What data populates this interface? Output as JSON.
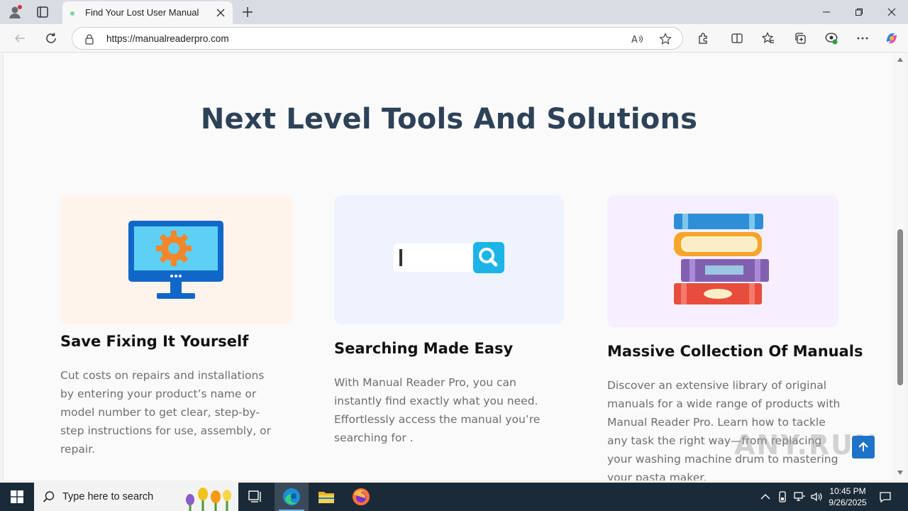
{
  "browser": {
    "tab_title": "Find Your Lost User Manual",
    "url": "https://manualreaderpro.com",
    "icons": [
      "profile-icon",
      "tab-actions-icon",
      "close-tab-icon",
      "new-tab-icon",
      "minimize-icon",
      "restore-icon",
      "close-window-icon",
      "back-icon",
      "refresh-icon",
      "site-info-icon",
      "read-aloud-icon",
      "favorite-add-icon",
      "extensions-icon",
      "split-screen-icon",
      "favorites-icon",
      "collections-icon",
      "browser-essentials-icon",
      "more-icon",
      "copilot-icon"
    ]
  },
  "page": {
    "section_title": "Next Level Tools And Solutions",
    "cards": [
      {
        "title": "Save Fixing It Yourself",
        "text": "Cut costs on repairs and installations by entering your product’s name or model number to get clear, step-by-step instructions for use, assembly, or repair.",
        "image": "monitor-gear-icon",
        "bg": "#fff4ec"
      },
      {
        "title": "Searching Made Easy",
        "text": "With Manual Reader Pro, you can instantly find exactly what you need. Effortlessly access the manual you’re searching for .",
        "image": "search-bar-icon",
        "bg": "#eef3fd"
      },
      {
        "title": "Massive Collection Of Manuals",
        "text": "Discover an extensive library of original manuals for a wide range of products with Manual Reader Pro. Learn how to tackle any task the right way—from replacing your washing machine drum to mastering your pasta maker.",
        "image": "books-stack-icon",
        "bg": "#f7efff"
      }
    ],
    "watermark": "ANY.RUN"
  },
  "taskbar": {
    "search_placeholder": "Type here to search",
    "time": "10:45 PM",
    "date": "9/26/2025"
  }
}
